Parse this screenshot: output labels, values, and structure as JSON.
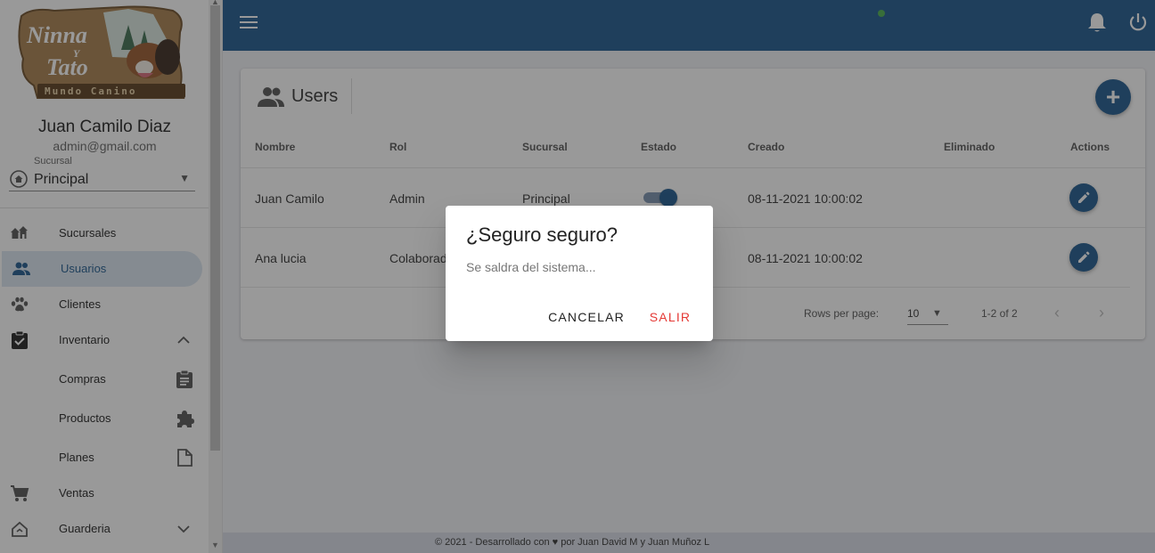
{
  "brand": {
    "logo_lines": [
      "Ninna",
      "Y",
      "Tato",
      "Mundo Canino"
    ]
  },
  "user": {
    "name": "Juan Camilo Diaz",
    "email": "admin@gmail.com"
  },
  "branch": {
    "label": "Sucursal",
    "value": "Principal"
  },
  "nav": {
    "items": [
      {
        "label": "Sucursales",
        "icon": "home-group-icon"
      },
      {
        "label": "Usuarios",
        "icon": "people-icon",
        "active": true
      },
      {
        "label": "Clientes",
        "icon": "paw-icon"
      },
      {
        "label": "Inventario",
        "icon": "clipboard-check-icon",
        "expanded": true
      },
      {
        "label": "Compras",
        "icon": "clipboard-text-icon"
      },
      {
        "label": "Productos",
        "icon": "puzzle-icon"
      },
      {
        "label": "Planes",
        "icon": "file-icon"
      },
      {
        "label": "Ventas",
        "icon": "cart-icon"
      },
      {
        "label": "Guarderia",
        "icon": "house-icon",
        "expanded": false
      }
    ]
  },
  "card": {
    "title": "Users",
    "columns": [
      "Nombre",
      "Rol",
      "Sucursal",
      "Estado",
      "Creado",
      "Eliminado",
      "Actions"
    ],
    "rows": [
      {
        "nombre": "Juan Camilo",
        "rol": "Admin",
        "sucursal": "Principal",
        "estado": true,
        "creado": "08-11-2021 10:00:02",
        "eliminado": ""
      },
      {
        "nombre": "Ana lucia",
        "rol": "Colaborador",
        "sucursal": "",
        "estado": true,
        "creado": "08-11-2021 10:00:02",
        "eliminado": ""
      }
    ],
    "pagination": {
      "rows_per_page_label": "Rows per page:",
      "rows_per_page": "10",
      "range": "1-2 of 2"
    }
  },
  "footer": {
    "text": "© 2021 -  Desarrollado con ♥ por Juan David M y Juan Muñoz L"
  },
  "dialog": {
    "title": "¿Seguro seguro?",
    "text": "Se saldra del sistema...",
    "cancel": "CANCELAR",
    "confirm": "SALIR"
  },
  "colors": {
    "primary": "#1f5a8e",
    "danger": "#e53935",
    "notification": "#4caf50"
  }
}
